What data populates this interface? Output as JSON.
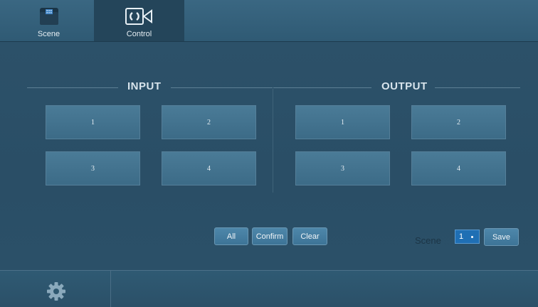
{
  "tabs": [
    {
      "label": "Scene",
      "icon": "scene-grid-folder-icon"
    },
    {
      "label": "Control",
      "icon": "control-camera-icon"
    }
  ],
  "input": {
    "title": "INPUT",
    "buttons": [
      "1",
      "2",
      "3",
      "4"
    ]
  },
  "output": {
    "title": "OUTPUT",
    "buttons": [
      "1",
      "2",
      "3",
      "4"
    ]
  },
  "actions": {
    "all": "All",
    "confirm": "Confirm",
    "clear": "Clear"
  },
  "scene": {
    "label": "Scene",
    "selected": "1",
    "save": "Save"
  },
  "bottom": {
    "icon": "gear-icon"
  }
}
